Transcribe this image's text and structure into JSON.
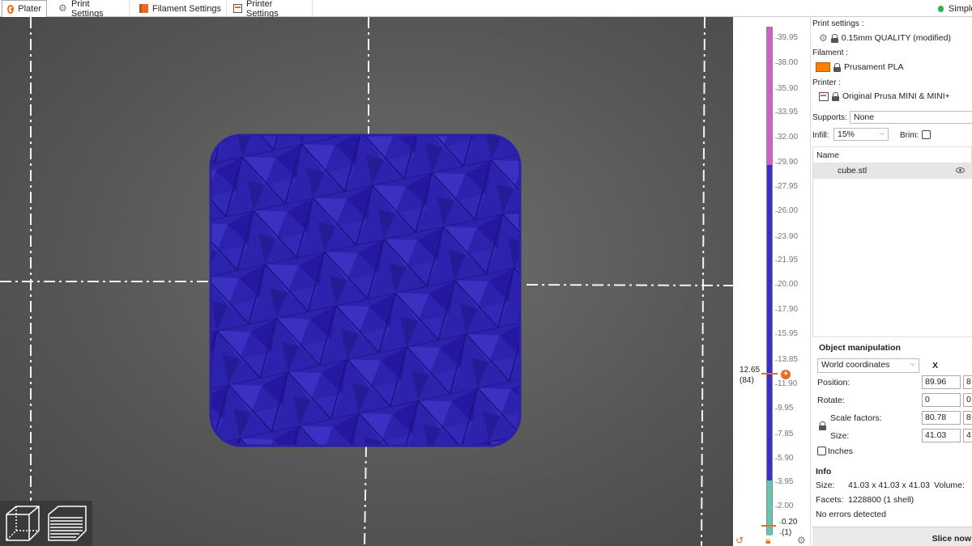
{
  "tabs": [
    {
      "label": "Plater",
      "icon": "plater-icon",
      "active": true
    },
    {
      "label": "Print Settings",
      "icon": "gear-icon",
      "active": false
    },
    {
      "label": "Filament Settings",
      "icon": "spool-icon",
      "active": false
    },
    {
      "label": "Printer Settings",
      "icon": "printer-icon",
      "active": false
    }
  ],
  "mode": {
    "label": "Simple",
    "color": "#27b34a"
  },
  "colors": {
    "accent": "#ed6b21",
    "model": "#2a1fa6",
    "filament_swatch": "#ff8000"
  },
  "layer_slider": {
    "ticks": [
      "39.95",
      "38.00",
      "35.90",
      "33.95",
      "32.00",
      "29.90",
      "27.95",
      "26.00",
      "23.90",
      "21.95",
      "20.00",
      "17.90",
      "15.95",
      "13.85",
      "11.90",
      "9.95",
      "7.85",
      "5.90",
      "3.95",
      "2.00"
    ],
    "top_value": "12.65",
    "top_layer": "(84)",
    "bottom_value": "0.20",
    "bottom_layer": "(1)"
  },
  "sidebar": {
    "print_settings_label": "Print settings :",
    "print_profile": "0.15mm QUALITY (modified)",
    "filament_label": "Filament :",
    "filament_profile": "Prusament PLA",
    "printer_label": "Printer :",
    "printer_profile": "Original Prusa MINI & MINI+",
    "supports_label": "Supports:",
    "supports_value": "None",
    "infill_label": "Infill:",
    "infill_value": "15%",
    "brim_label": "Brim:",
    "objects_header": "Name",
    "object_name": "cube.stl"
  },
  "manipulation": {
    "title": "Object manipulation",
    "coords": "World coordinates",
    "axis_x": "X",
    "position_label": "Position:",
    "position_x": "89.96",
    "position_y_partial": "8",
    "rotate_label": "Rotate:",
    "rotate_x": "0",
    "rotate_y_partial": "0",
    "scale_label": "Scale factors:",
    "scale_x": "80.78",
    "scale_y_partial": "8",
    "size_label": "Size:",
    "size_x": "41.03",
    "size_y_partial": "4",
    "inches_label": "Inches"
  },
  "info": {
    "title": "Info",
    "size_label": "Size:",
    "size_value": "41.03 x 41.03 x 41.03",
    "volume_label": "Volume:",
    "facets_label": "Facets:",
    "facets_value": "1228800 (1 shell)",
    "errors": "No errors detected"
  },
  "slice_button": "Slice now"
}
